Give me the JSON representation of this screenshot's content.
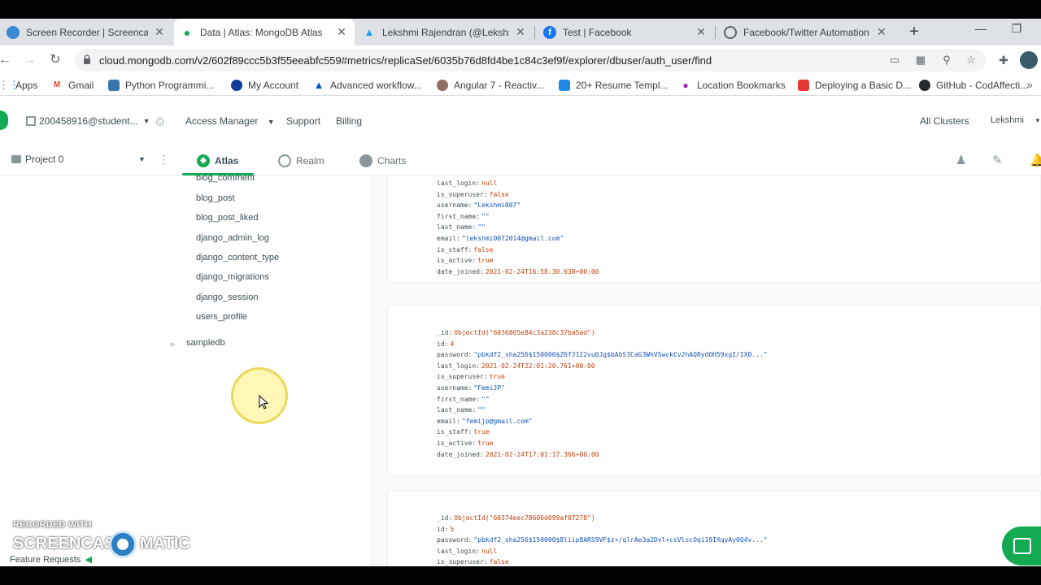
{
  "browser": {
    "tabs": [
      {
        "title": "Screen Recorder | Screencast-O",
        "favicon_color": "#3a88d0",
        "active": false
      },
      {
        "title": "Data | Atlas: MongoDB Atlas",
        "favicon_color": "#13aa52",
        "active": true
      },
      {
        "title": "Lekshmi Rajendran (@Lekshmi",
        "favicon_color": "#1da1f2",
        "active": false
      },
      {
        "title": "Test | Facebook",
        "favicon_color": "#1877f2",
        "active": false
      },
      {
        "title": "Facebook/Twitter Automation",
        "favicon_color": "#5f6368",
        "active": false
      }
    ],
    "url": "cloud.mongodb.com/v2/602f89ccc5b3f55eeabfc559#metrics/replicaSet/6035b76d8fd4be1c84c3ef9f/explorer/dbuser/auth_user/find",
    "bookmarks": [
      {
        "label": "Apps",
        "icon_color": "#4285f4"
      },
      {
        "label": "Gmail",
        "icon_color": "#ea4335"
      },
      {
        "label": "Python Programmi...",
        "icon_color": "#3776ab"
      },
      {
        "label": "My Account",
        "icon_color": "#0f3c96"
      },
      {
        "label": "Advanced workflow...",
        "icon_color": "#0052cc"
      },
      {
        "label": "Angular 7 - Reactiv...",
        "icon_color": "#8d6e63"
      },
      {
        "label": "20+ Resume Templ...",
        "icon_color": "#1e88e5"
      },
      {
        "label": "Location Bookmarks",
        "icon_color": "#9c27b0"
      },
      {
        "label": "Deploying a Basic D...",
        "icon_color": "#e53935"
      },
      {
        "label": "GitHub - CodAffecti...",
        "icon_color": "#24292e"
      }
    ]
  },
  "atlas": {
    "org": "200458916@student...",
    "topnav": {
      "access_manager": "Access Manager",
      "support": "Support",
      "billing": "Billing",
      "all_clusters": "All Clusters",
      "user": "Lekshmi"
    },
    "project": "Project 0",
    "products": {
      "atlas": "Atlas",
      "realm": "Realm",
      "charts": "Charts"
    },
    "collections": [
      "blog_comment",
      "blog_post",
      "blog_post_liked",
      "django_admin_log",
      "django_content_type",
      "django_migrations",
      "django_session",
      "users_profile"
    ],
    "database": "sampledb",
    "documents": [
      {
        "fields": [
          {
            "key": "last_login",
            "value": "null",
            "kind": "bool"
          },
          {
            "key": "is_superuser",
            "value": "false",
            "kind": "bool"
          },
          {
            "key": "username",
            "value": "\"Lekshmi007\"",
            "kind": "str"
          },
          {
            "key": "first_name",
            "value": "\"\"",
            "kind": "str"
          },
          {
            "key": "last_name",
            "value": "\"\"",
            "kind": "str"
          },
          {
            "key": "email",
            "value": "\"lekshmi0072014@gmail.com\"",
            "kind": "str"
          },
          {
            "key": "is_staff",
            "value": "false",
            "kind": "bool"
          },
          {
            "key": "is_active",
            "value": "true",
            "kind": "bool"
          },
          {
            "key": "date_joined",
            "value": "2021-02-24T16:58:30.638+00:00",
            "kind": "date"
          }
        ]
      },
      {
        "fields": [
          {
            "key": "_id",
            "value": "ObjectId(\"6036865e84c3a238c37ba5ad\")",
            "kind": "oid"
          },
          {
            "key": "id",
            "value": "4",
            "kind": "num"
          },
          {
            "key": "password",
            "value": "\"pbkdf2_sha256$150000$Z6fJ122vu0Jg$bAbS3CaG3WhVSwckCv2hAQ8ydOH59xgI/IX0...\"",
            "kind": "str"
          },
          {
            "key": "last_login",
            "value": "2021-02-24T22:01:20.761+00:00",
            "kind": "date"
          },
          {
            "key": "is_superuser",
            "value": "true",
            "kind": "bool"
          },
          {
            "key": "username",
            "value": "\"FemiJP\"",
            "kind": "str"
          },
          {
            "key": "first_name",
            "value": "\"\"",
            "kind": "str"
          },
          {
            "key": "last_name",
            "value": "\"\"",
            "kind": "str"
          },
          {
            "key": "email",
            "value": "\"femijp@gmail.com\"",
            "kind": "str"
          },
          {
            "key": "is_staff",
            "value": "true",
            "kind": "bool"
          },
          {
            "key": "is_active",
            "value": "true",
            "kind": "bool"
          },
          {
            "key": "date_joined",
            "value": "2021-02-24T17:01:17.366+00:00",
            "kind": "date"
          }
        ]
      },
      {
        "fields": [
          {
            "key": "_id",
            "value": "ObjectId(\"60374eec78606d099af07278\")",
            "kind": "oid"
          },
          {
            "key": "id",
            "value": "5",
            "kind": "num"
          },
          {
            "key": "password",
            "value": "\"pbkdf2_sha256$150000$8liip8ARS9VF$z+/qlrAe3a2Dvl+csVlscOqi19IXqyAy0Q4v...\"",
            "kind": "str"
          },
          {
            "key": "last_login",
            "value": "null",
            "kind": "bool"
          },
          {
            "key": "is_superuser",
            "value": "false",
            "kind": "bool"
          }
        ]
      }
    ]
  },
  "watermark": {
    "recorded_with": "RECORDED WITH",
    "brand_left": "SCREENCAST",
    "brand_right": "MATIC",
    "feature_requests": "Feature Requests"
  },
  "colors": {
    "accent": "#13aa52",
    "link": "#1254b7",
    "value": "#c2410c"
  }
}
